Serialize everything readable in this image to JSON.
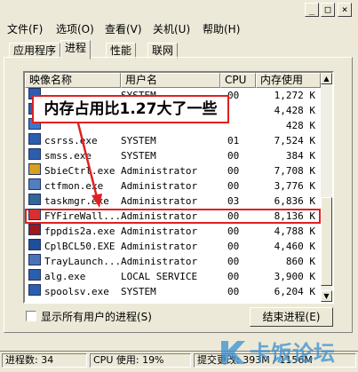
{
  "menu": [
    "文件(F)",
    "选项(O)",
    "查看(V)",
    "关机(U)",
    "帮助(H)"
  ],
  "window_controls": {
    "minimize": "_",
    "maximize": "□",
    "close": "×"
  },
  "tabs": [
    "应用程序",
    "进程",
    "性能",
    "联网"
  ],
  "columns": [
    "映像名称",
    "用户名",
    "CPU",
    "内存使用"
  ],
  "rows": [
    {
      "name": "",
      "user": "SYSTEM",
      "cpu": "00",
      "mem": "1,272 K"
    },
    {
      "name": "",
      "user": "",
      "cpu": "",
      "mem": "4,428 K"
    },
    {
      "name": "",
      "user": "",
      "cpu": "",
      "mem": "428 K"
    },
    {
      "name": "csrss.exe",
      "user": "SYSTEM",
      "cpu": "01",
      "mem": "7,524 K"
    },
    {
      "name": "smss.exe",
      "user": "SYSTEM",
      "cpu": "00",
      "mem": "384 K"
    },
    {
      "name": "SbieCtrl.exe",
      "user": "Administrator",
      "cpu": "00",
      "mem": "7,708 K"
    },
    {
      "name": "ctfmon.exe",
      "user": "Administrator",
      "cpu": "00",
      "mem": "3,776 K"
    },
    {
      "name": "taskmgr.exe",
      "user": "Administrator",
      "cpu": "03",
      "mem": "6,836 K"
    },
    {
      "name": "FYFireWall...",
      "user": "Administrator",
      "cpu": "00",
      "mem": "8,136 K",
      "selected": true
    },
    {
      "name": "fppdis2a.exe",
      "user": "Administrator",
      "cpu": "00",
      "mem": "4,788 K"
    },
    {
      "name": "CplBCL50.EXE",
      "user": "Administrator",
      "cpu": "00",
      "mem": "4,460 K"
    },
    {
      "name": "TrayLaunch...",
      "user": "Administrator",
      "cpu": "00",
      "mem": "860 K"
    },
    {
      "name": "alg.exe",
      "user": "LOCAL SERVICE",
      "cpu": "00",
      "mem": "3,900 K"
    },
    {
      "name": "spoolsv.exe",
      "user": "SYSTEM",
      "cpu": "00",
      "mem": "6,204 K"
    }
  ],
  "icon_names": [
    "window-icon",
    "window-icon",
    "app-icon",
    "window-icon",
    "window-icon",
    "sandboxie-icon",
    "ctfmon-icon",
    "taskmgr-icon",
    "firewall-icon",
    "pdf-icon",
    "bcl-icon",
    "traylaunch-icon",
    "window-icon",
    "window-icon"
  ],
  "callout": "内存占用比1.27大了一些",
  "show_all_users": "显示所有用户的进程(S)",
  "end_process": "结束进程(E)",
  "status": {
    "processes": "进程数: 34",
    "cpu": "CPU 使用: 19%",
    "commit": "提交更改: 393M / 1156M"
  },
  "watermark": "卡饭论坛",
  "colors": {
    "highlight": "#e02020",
    "system_bg": "#ece9d8",
    "watermark": "#3a8fd0"
  }
}
